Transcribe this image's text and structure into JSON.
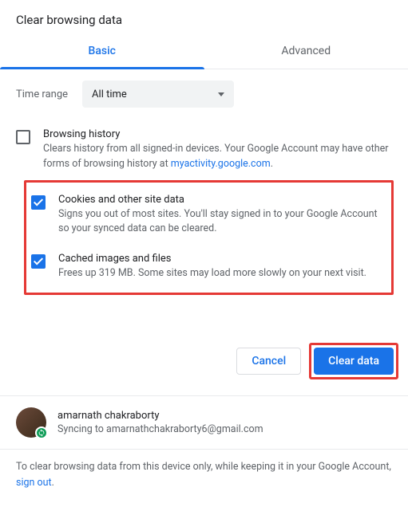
{
  "title": "Clear browsing data",
  "tabs": {
    "basic": "Basic",
    "advanced": "Advanced"
  },
  "time": {
    "label": "Time range",
    "value": "All time"
  },
  "opts": {
    "history": {
      "title": "Browsing history",
      "desc_a": "Clears history from all signed-in devices. Your Google Account may have other forms of browsing history at ",
      "desc_link": "myactivity.google.com",
      "desc_b": "."
    },
    "cookies": {
      "title": "Cookies and other site data",
      "desc": "Signs you out of most sites. You'll stay signed in to your Google Account so your synced data can be cleared."
    },
    "cache": {
      "title": "Cached images and files",
      "desc": "Frees up 319 MB. Some sites may load more slowly on your next visit."
    }
  },
  "buttons": {
    "cancel": "Cancel",
    "clear": "Clear data"
  },
  "user": {
    "name": "amarnath chakraborty",
    "email": "Syncing to amarnathchakraborty6@gmail.com"
  },
  "footer": {
    "a": "To clear browsing data from this device only, while keeping it in your Google Account, ",
    "link": "sign out",
    "b": "."
  }
}
